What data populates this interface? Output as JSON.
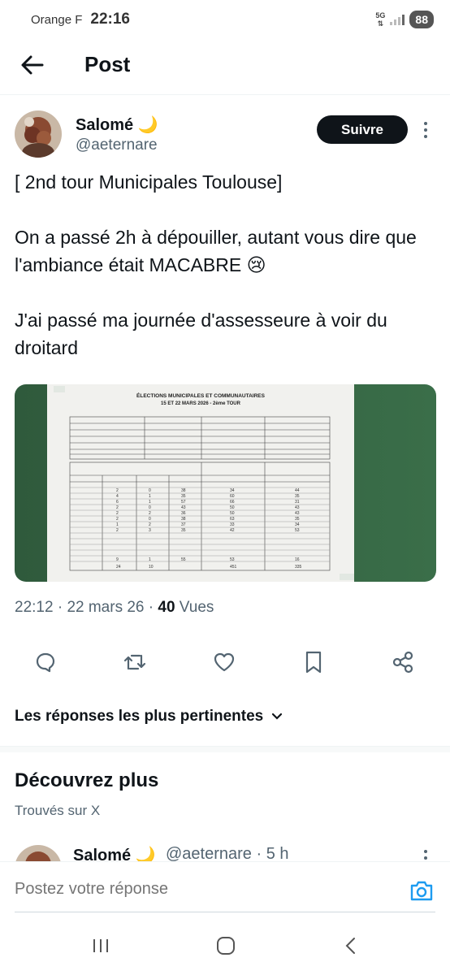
{
  "status": {
    "carrier": "Orange F",
    "time": "22:16",
    "network": "5G",
    "battery": "88"
  },
  "header": {
    "title": "Post"
  },
  "author": {
    "name": "Salomé 🌙",
    "handle": "@aeternare",
    "follow_label": "Suivre"
  },
  "tweet": {
    "line1": "[ 2nd tour Municipales Toulouse]",
    "line2": "On a passé 2h à dépouiller, autant vous dire que l'ambiance était MACABRE 😢",
    "line3": "J'ai passé ma journée d'assesseure à voir du droitard"
  },
  "photo": {
    "title1": "ÉLECTIONS MUNICIPALES ET COMMUNAUTAIRES",
    "title2": "15 ET 22 MARS 2026 - 2ème TOUR"
  },
  "meta": {
    "time": "22:12",
    "date": "22 mars 26",
    "views_count": "40",
    "views_label": "Vues"
  },
  "icons": {
    "reply": "reply-icon",
    "retweet": "retweet-icon",
    "like": "heart-icon",
    "bookmark": "bookmark-icon",
    "share": "share-icon"
  },
  "replies_sort": {
    "label": "Les réponses les plus pertinentes"
  },
  "discover": {
    "title": "Découvrez plus",
    "subtitle": "Trouvés sur X"
  },
  "peek": {
    "name": "Salomé 🌙",
    "handle_time": "@aeternare · 5 h"
  },
  "reply_bar": {
    "placeholder": "Postez votre réponse"
  },
  "colors": {
    "text": "#0f1419",
    "secondary": "#536471",
    "accent": "#1d9bf0",
    "follow_bg": "#0f1419"
  }
}
